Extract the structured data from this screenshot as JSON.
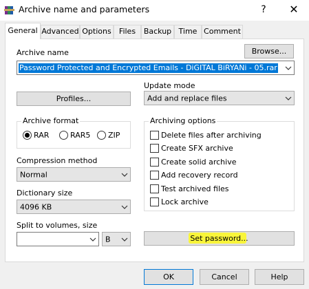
{
  "window": {
    "title": "Archive name and parameters",
    "help_glyph": "?",
    "close_glyph": "✕"
  },
  "tabs": [
    {
      "label": "General",
      "active": true
    },
    {
      "label": "Advanced",
      "active": false
    },
    {
      "label": "Options",
      "active": false
    },
    {
      "label": "Files",
      "active": false
    },
    {
      "label": "Backup",
      "active": false
    },
    {
      "label": "Time",
      "active": false
    },
    {
      "label": "Comment",
      "active": false
    }
  ],
  "archive_name": {
    "label": "Archive name",
    "browse_label": "Browse...",
    "value": "Password Protected and Encrypted Emails - DiGITAL BiRYANi - 05.rar"
  },
  "profiles": {
    "button_label": "Profiles..."
  },
  "update_mode": {
    "label": "Update mode",
    "selected": "Add and replace files"
  },
  "archive_format": {
    "label": "Archive format",
    "options": [
      {
        "label": "RAR",
        "selected": true
      },
      {
        "label": "RAR5",
        "selected": false
      },
      {
        "label": "ZIP",
        "selected": false
      }
    ]
  },
  "archiving_options": {
    "label": "Archiving options",
    "items": [
      {
        "label": "Delete files after archiving",
        "checked": false
      },
      {
        "label": "Create SFX archive",
        "checked": false
      },
      {
        "label": "Create solid archive",
        "checked": false
      },
      {
        "label": "Add recovery record",
        "checked": false
      },
      {
        "label": "Test archived files",
        "checked": false
      },
      {
        "label": "Lock archive",
        "checked": false
      }
    ]
  },
  "compression": {
    "label": "Compression method",
    "selected": "Normal"
  },
  "dictionary": {
    "label": "Dictionary size",
    "selected": "4096 KB"
  },
  "split": {
    "label": "Split to volumes, size",
    "value": "",
    "unit": "B"
  },
  "set_password": {
    "label": "Set password..."
  },
  "footer": {
    "ok": "OK",
    "cancel": "Cancel",
    "help": "Help"
  },
  "colors": {
    "selection": "#0078d7",
    "highlight": "#f9f53a",
    "panel": "#ffffff",
    "dialog": "#f0f0f0"
  },
  "icons": {
    "app": "winrar-books-icon",
    "dropdown": "chevron-down-icon"
  }
}
